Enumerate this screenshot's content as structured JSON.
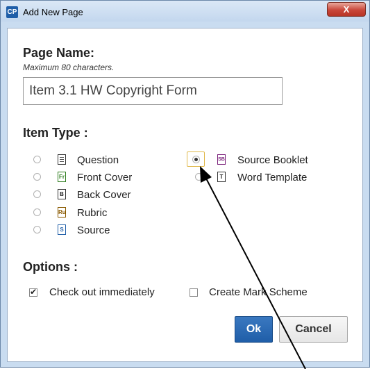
{
  "window": {
    "title": "Add New Page",
    "app_icon": "CP",
    "close_label": "X"
  },
  "page_name": {
    "title": "Page Name:",
    "hint": "Maximum 80 characters.",
    "value": "Item 3.1 HW Copyright Form"
  },
  "item_type": {
    "title": "Item Type :",
    "options": [
      {
        "label": "Question",
        "icon": "lines",
        "checked": false
      },
      {
        "label": "Front Cover",
        "icon": "Fr",
        "checked": false
      },
      {
        "label": "Back Cover",
        "icon": "B",
        "checked": false
      },
      {
        "label": "Rubric",
        "icon": "Ru",
        "checked": false
      },
      {
        "label": "Source",
        "icon": "S",
        "checked": false
      },
      {
        "label": "Source Booklet",
        "icon": "SB",
        "checked": true
      },
      {
        "label": "Word Template",
        "icon": "T",
        "checked": false
      }
    ]
  },
  "options": {
    "title": "Options :",
    "check_out": {
      "label": "Check out immediately",
      "checked": true
    },
    "mark_scheme": {
      "label": "Create Mark Scheme",
      "checked": false
    }
  },
  "buttons": {
    "ok": "Ok",
    "cancel": "Cancel"
  },
  "colors": {
    "accent": "#1f5ea8",
    "frame": "#c9dcf0",
    "close": "#c9473a",
    "highlight": "#e0b84a"
  }
}
